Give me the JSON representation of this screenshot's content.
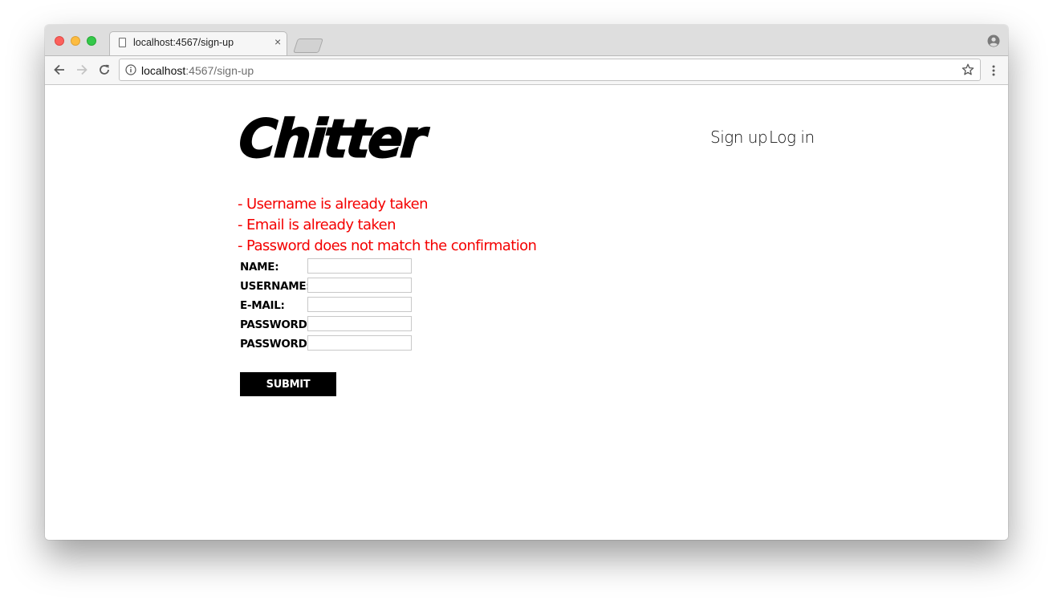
{
  "browser": {
    "tab_title": "localhost:4567/sign-up",
    "tab_close": "×",
    "url_host": "localhost",
    "url_rest": ":4567/sign-up",
    "icons": {
      "back": "arrow-left-icon",
      "forward": "arrow-right-icon",
      "reload": "reload-icon",
      "info": "info-icon",
      "star": "star-icon",
      "menu": "vertical-dots-icon",
      "profile": "profile-icon",
      "page": "page-icon"
    }
  },
  "site": {
    "logo": "Chitter",
    "nav": {
      "sign_up": "Sign up",
      "log_in": "Log in"
    }
  },
  "errors": [
    "- Username is already taken",
    "- Email is already taken",
    "- Password does not match the confirmation"
  ],
  "form": {
    "fields": [
      {
        "label": "NAME:",
        "value": ""
      },
      {
        "label": "USERNAME:",
        "value": ""
      },
      {
        "label": "E-MAIL:",
        "value": ""
      },
      {
        "label": "PASSWORD:",
        "value": ""
      },
      {
        "label": "PASSWORD:",
        "value": ""
      }
    ],
    "submit_label": "SUBMIT"
  },
  "colors": {
    "error": "#f40000",
    "button_bg": "#000000",
    "button_text": "#ffffff"
  }
}
